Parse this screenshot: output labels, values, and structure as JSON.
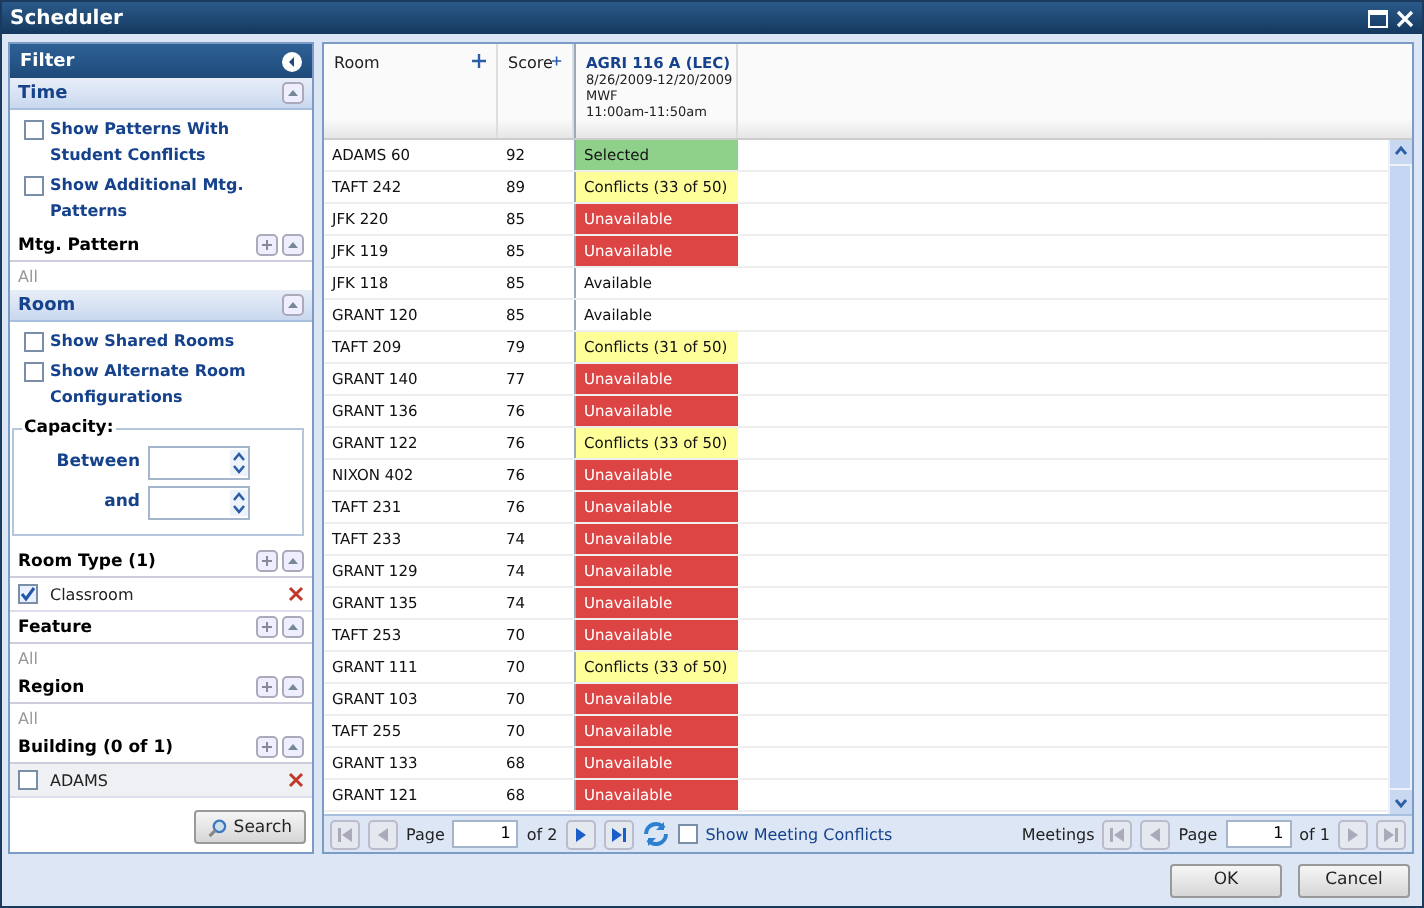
{
  "window": {
    "title": "Scheduler"
  },
  "filter": {
    "title": "Filter",
    "time": {
      "title": "Time",
      "options": [
        {
          "label": "Show Patterns With Student Conflicts",
          "checked": false
        },
        {
          "label": "Show Additional Mtg. Patterns",
          "checked": false
        }
      ],
      "mtg_pattern": {
        "title": "Mtg. Pattern",
        "value": "All"
      }
    },
    "room": {
      "title": "Room",
      "options": [
        {
          "label": "Show Shared Rooms",
          "checked": false
        },
        {
          "label": "Show Alternate Room Configurations",
          "checked": false
        }
      ],
      "capacity": {
        "title": "Capacity:",
        "between_label": "Between",
        "and_label": "and"
      },
      "lists": [
        {
          "title": "Room Type (1)",
          "items": [
            {
              "label": "Classroom",
              "checked": true
            }
          ]
        },
        {
          "title": "Feature",
          "empty": "All"
        },
        {
          "title": "Region",
          "empty": "All"
        },
        {
          "title": "Building (0 of 1)",
          "items": [
            {
              "label": "ADAMS",
              "checked": false
            }
          ]
        }
      ]
    },
    "search_button": "Search"
  },
  "grid": {
    "columns": [
      "Room",
      "Score"
    ],
    "section": {
      "title": "AGRI 116 A (LEC)",
      "dates": "8/26/2009-12/20/2009",
      "days": "MWF",
      "time": "11:00am-11:50am"
    },
    "rows": [
      {
        "room": "ADAMS 60",
        "score": "92",
        "kind": "selected",
        "status": "Selected"
      },
      {
        "room": "TAFT 242",
        "score": "89",
        "kind": "conflict",
        "status": "Conflicts (33 of 50)"
      },
      {
        "room": "JFK 220",
        "score": "85",
        "kind": "unavailable",
        "status": "Unavailable"
      },
      {
        "room": "JFK 119",
        "score": "85",
        "kind": "unavailable",
        "status": "Unavailable"
      },
      {
        "room": "JFK 118",
        "score": "85",
        "kind": "available",
        "status": "Available"
      },
      {
        "room": "GRANT 120",
        "score": "85",
        "kind": "available",
        "status": "Available"
      },
      {
        "room": "TAFT 209",
        "score": "79",
        "kind": "conflict",
        "status": "Conflicts (31 of 50)"
      },
      {
        "room": "GRANT 140",
        "score": "77",
        "kind": "unavailable",
        "status": "Unavailable"
      },
      {
        "room": "GRANT 136",
        "score": "76",
        "kind": "unavailable",
        "status": "Unavailable"
      },
      {
        "room": "GRANT 122",
        "score": "76",
        "kind": "conflict",
        "status": "Conflicts (33 of 50)"
      },
      {
        "room": "NIXON 402",
        "score": "76",
        "kind": "unavailable",
        "status": "Unavailable"
      },
      {
        "room": "TAFT 231",
        "score": "76",
        "kind": "unavailable",
        "status": "Unavailable"
      },
      {
        "room": "TAFT 233",
        "score": "74",
        "kind": "unavailable",
        "status": "Unavailable"
      },
      {
        "room": "GRANT 129",
        "score": "74",
        "kind": "unavailable",
        "status": "Unavailable"
      },
      {
        "room": "GRANT 135",
        "score": "74",
        "kind": "unavailable",
        "status": "Unavailable"
      },
      {
        "room": "TAFT 253",
        "score": "70",
        "kind": "unavailable",
        "status": "Unavailable"
      },
      {
        "room": "GRANT 111",
        "score": "70",
        "kind": "conflict",
        "status": "Conflicts (33 of 50)"
      },
      {
        "room": "GRANT 103",
        "score": "70",
        "kind": "unavailable",
        "status": "Unavailable"
      },
      {
        "room": "TAFT 255",
        "score": "70",
        "kind": "unavailable",
        "status": "Unavailable"
      },
      {
        "room": "GRANT 133",
        "score": "68",
        "kind": "unavailable",
        "status": "Unavailable"
      },
      {
        "room": "GRANT 121",
        "score": "68",
        "kind": "unavailable",
        "status": "Unavailable"
      }
    ],
    "pager": {
      "page_label": "Page",
      "page": "1",
      "of": "of 2",
      "conflicts_label": "Show Meeting Conflicts",
      "conflicts_checked": false,
      "meetings_label": "Meetings",
      "m_page_label": "Page",
      "m_page": "1",
      "m_of": "of 1"
    }
  },
  "buttons": [
    "OK",
    "Cancel"
  ]
}
